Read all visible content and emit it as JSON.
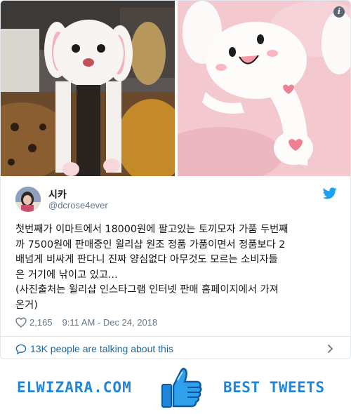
{
  "tweet": {
    "display_name": "시카",
    "handle": "@dcrose4ever",
    "text": "첫번째가 이마트에서 18000원에 팔고있는 토끼모자 가품 두번째\n까 7500원에 판매중인 윌리샵 원조 정품 가품이면서 정품보다 2\n배넘게 비싸게 판다니 진짜 양심없다 아무것도 모르는 소비자들\n은 거기에 낚이고 있고...\n(사진출처는 윌리샵 인스타그램 인터넷 판매 홈페이지에서 가져\n온거)",
    "likes": "2,165",
    "timestamp": "9:11 AM - Dec 24, 2018",
    "conversation": "13K people are talking about this",
    "icons": {
      "info": "info-icon",
      "twitter": "twitter-bird-icon",
      "heart": "heart-icon",
      "bubble": "speech-bubble-icon",
      "chevron": "chevron-right-icon"
    },
    "colors": {
      "link": "#1b6aa5",
      "twitter": "#1da1f2",
      "muted": "#657786"
    }
  },
  "banner": {
    "left_label": "ELWIZARA.COM",
    "right_label": "BEST TWEETS",
    "icon": "thumbs-up-icon",
    "color": "#2186d8"
  }
}
